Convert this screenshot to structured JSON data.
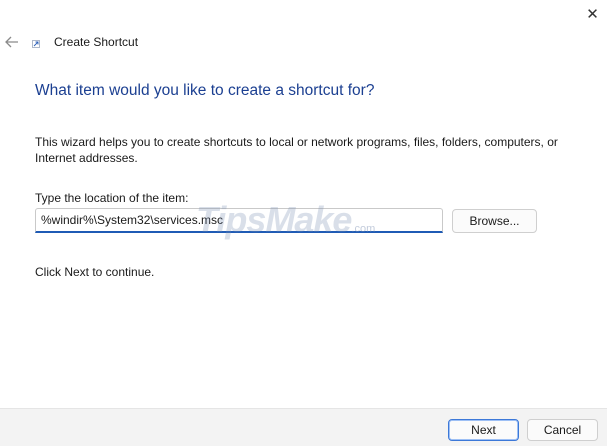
{
  "window": {
    "title": "Create Shortcut",
    "close_icon": "close-icon",
    "back_icon": "arrow-left-icon",
    "app_icon": "shortcut-icon"
  },
  "wizard": {
    "heading": "What item would you like to create a shortcut for?",
    "description": "This wizard helps you to create shortcuts to local or network programs, files, folders, computers, or Internet addresses.",
    "location_label": "Type the location of the item:",
    "location_value": "%windir%\\System32\\services.msc",
    "browse_label": "Browse...",
    "continue_text": "Click Next to continue."
  },
  "watermark": {
    "brand": "TipsMake",
    "suffix": ".com"
  },
  "footer": {
    "next_label": "Next",
    "cancel_label": "Cancel"
  },
  "colors": {
    "heading": "#1b3f91",
    "input_focus_border": "#1f5bb5",
    "footer_bg": "#f3f3f3"
  }
}
